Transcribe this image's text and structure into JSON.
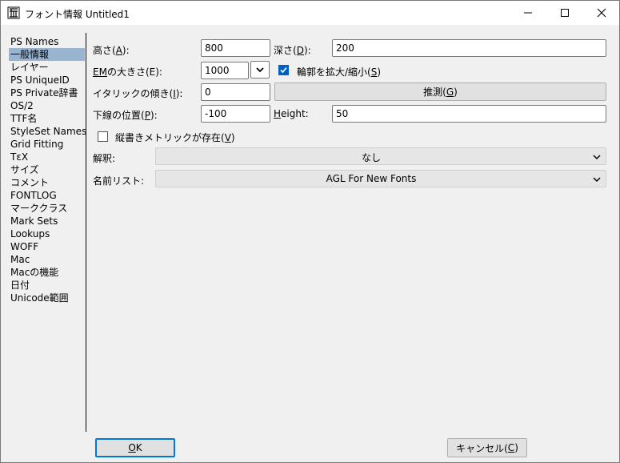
{
  "window": {
    "title": "フォント情報 Untitled1",
    "app_icon": "fontforge-icon",
    "controls": {
      "minimize": "minimize-icon",
      "maximize": "maximize-icon",
      "close": "close-icon"
    }
  },
  "sidebar": {
    "items": [
      {
        "label": "PS Names"
      },
      {
        "label": "一般情報",
        "selected": true
      },
      {
        "label": "レイヤー"
      },
      {
        "label": "PS UniqueID"
      },
      {
        "label": "PS Private辞書"
      },
      {
        "label": "OS/2"
      },
      {
        "label": "TTF名"
      },
      {
        "label": "StyleSet Names"
      },
      {
        "label": "Grid Fitting"
      },
      {
        "label": "TεX"
      },
      {
        "label": "サイズ"
      },
      {
        "label": "コメント"
      },
      {
        "label": "FONTLOG"
      },
      {
        "label": "マーククラス"
      },
      {
        "label": "Mark Sets"
      },
      {
        "label": "Lookups"
      },
      {
        "label": "WOFF"
      },
      {
        "label": "Mac"
      },
      {
        "label": "Macの機能"
      },
      {
        "label": "日付"
      },
      {
        "label": "Unicode範囲"
      }
    ],
    "selected_color": "#99b4d1"
  },
  "general": {
    "ascent": {
      "pre": "高さ(",
      "key": "A",
      "post": "):",
      "value": "800"
    },
    "descent": {
      "pre": "深さ(",
      "key": "D",
      "post": "):",
      "value": "200"
    },
    "em_size": {
      "pre": "",
      "key": "EM",
      "post": "の大きさ(E):",
      "value": "1000"
    },
    "scale_outlines": {
      "pre": "輪郭を拡大/縮小(",
      "key": "S",
      "post": ")",
      "checked": true
    },
    "italic_angle": {
      "pre": "イタリックの傾き(",
      "key": "I",
      "post": "):",
      "value": "0"
    },
    "guess_button": {
      "pre": "推測(",
      "key": "G",
      "post": ")"
    },
    "underline_pos": {
      "pre": "下線の位置(",
      "key": "P",
      "post": "):",
      "value": "-100"
    },
    "underline_height": {
      "pre": "",
      "key": "H",
      "post": "eight:",
      "value": "50"
    },
    "vertical_metrics": {
      "pre": "縦書きメトリックが存在(",
      "key": "V",
      "post": ")",
      "checked": false
    },
    "interpretation": {
      "label": "解釈:",
      "value": "なし"
    },
    "namelist": {
      "label": "名前リスト:",
      "value": "AGL For New Fonts"
    }
  },
  "footer": {
    "ok": {
      "pre": "",
      "key": "O",
      "post": "K"
    },
    "cancel": {
      "pre": "キャンセル(",
      "key": "C",
      "post": ")"
    }
  },
  "colors": {
    "checkbox_checked": "#0060c0",
    "default_button_border": "#0078d7"
  }
}
